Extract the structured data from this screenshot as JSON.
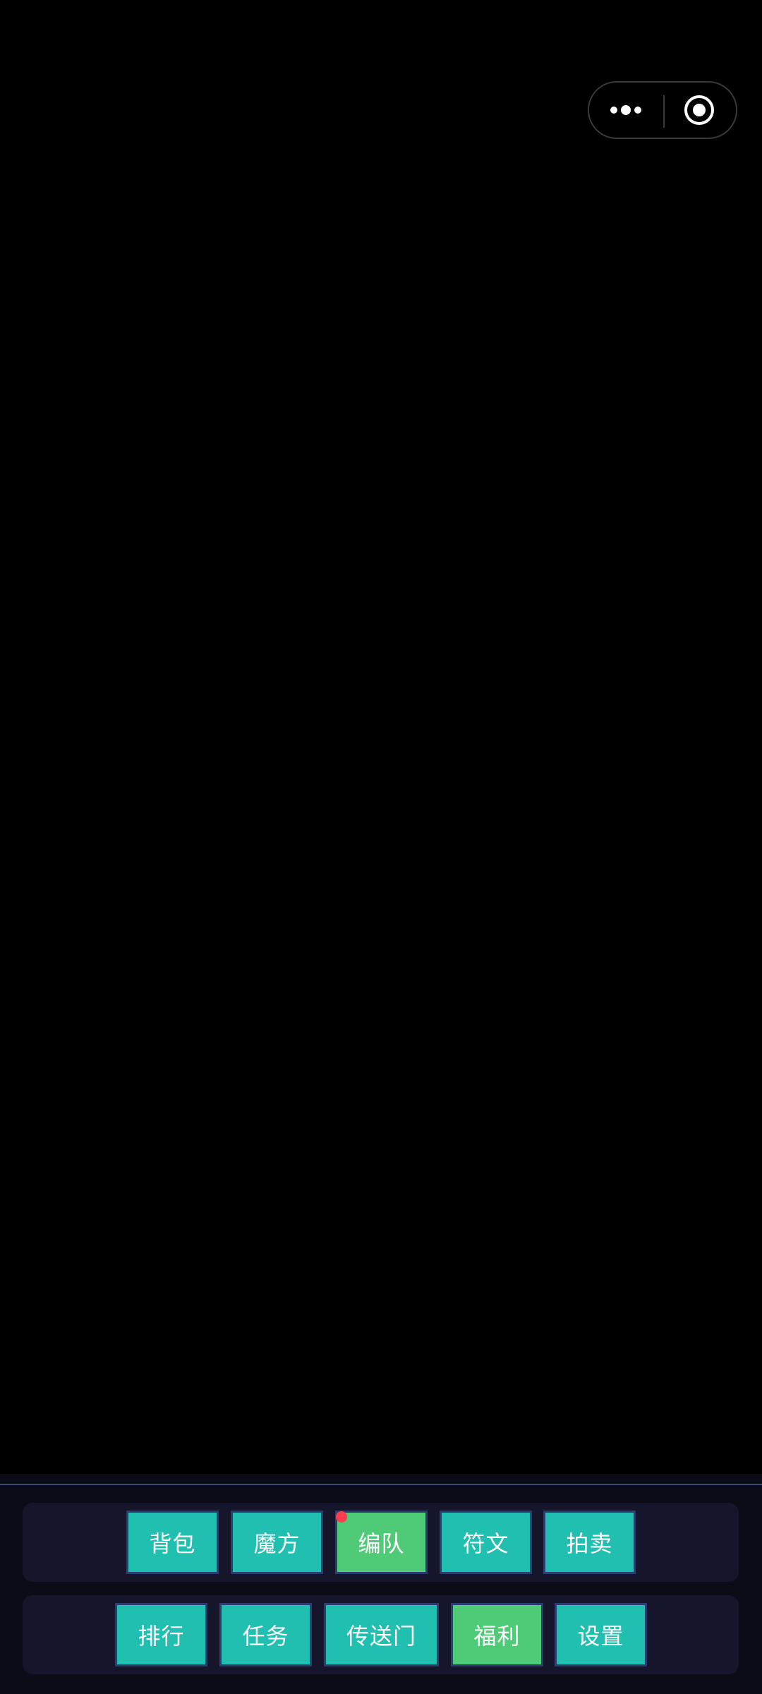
{
  "capsule": {
    "more_icon": "more-dots-icon",
    "close_icon": "target-circle-icon"
  },
  "bottom_bar": {
    "row1": [
      {
        "label": "背包",
        "color": "#20bfb0",
        "badge": false
      },
      {
        "label": "魔方",
        "color": "#20bfb0",
        "badge": false
      },
      {
        "label": "编队",
        "color": "#4fcb77",
        "badge": true
      },
      {
        "label": "符文",
        "color": "#20bfb0",
        "badge": false
      },
      {
        "label": "拍卖",
        "color": "#20bfb0",
        "badge": false
      }
    ],
    "row2": [
      {
        "label": "排行",
        "color": "#20bfb0",
        "badge": false
      },
      {
        "label": "任务",
        "color": "#20bfb0",
        "badge": false
      },
      {
        "label": "传送门",
        "color": "#20bfb0",
        "badge": false
      },
      {
        "label": "福利",
        "color": "#4fcb77",
        "badge": false
      },
      {
        "label": "设置",
        "color": "#20bfb0",
        "badge": false
      }
    ]
  },
  "colors": {
    "background": "#000000",
    "panel": "#15152b",
    "button_teal": "#20bfb0",
    "button_green": "#4fcb77",
    "button_border": "#2c3d74",
    "badge": "#ff3b4f"
  }
}
